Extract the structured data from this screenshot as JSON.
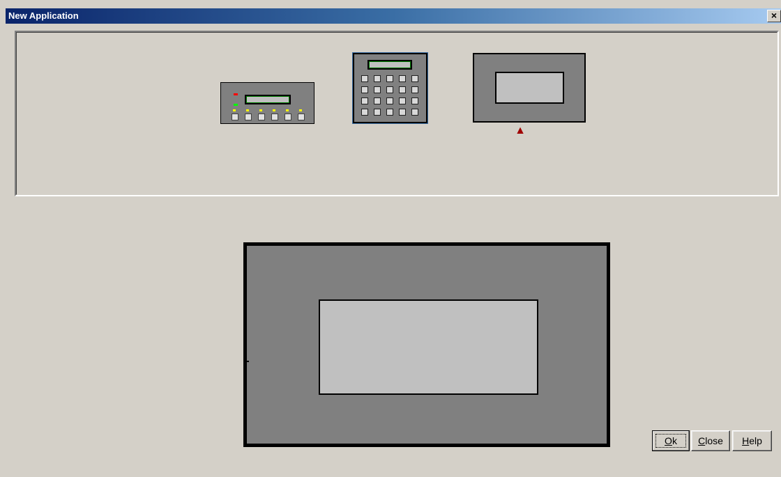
{
  "window": {
    "title": "New Application",
    "close_glyph": "×"
  },
  "templates": [
    {
      "name": "text-terminal",
      "selected": false
    },
    {
      "name": "keypad-terminal",
      "selected": false
    },
    {
      "name": "graphic-terminal",
      "selected": true
    }
  ],
  "selected_indicator_icon": "up-arrow-icon",
  "selected_indicator_glyph": "▲",
  "buttons": {
    "ok": {
      "accel": "O",
      "rest": "k"
    },
    "close": {
      "accel": "C",
      "rest": "lose"
    },
    "help": {
      "accel": "H",
      "rest": "elp"
    }
  },
  "colors": {
    "title_gradient_start": "#0a246a",
    "title_gradient_end": "#a6caf0",
    "device_body": "#808080",
    "device_screen": "#c0c0c0",
    "arrow": "#a00000"
  }
}
